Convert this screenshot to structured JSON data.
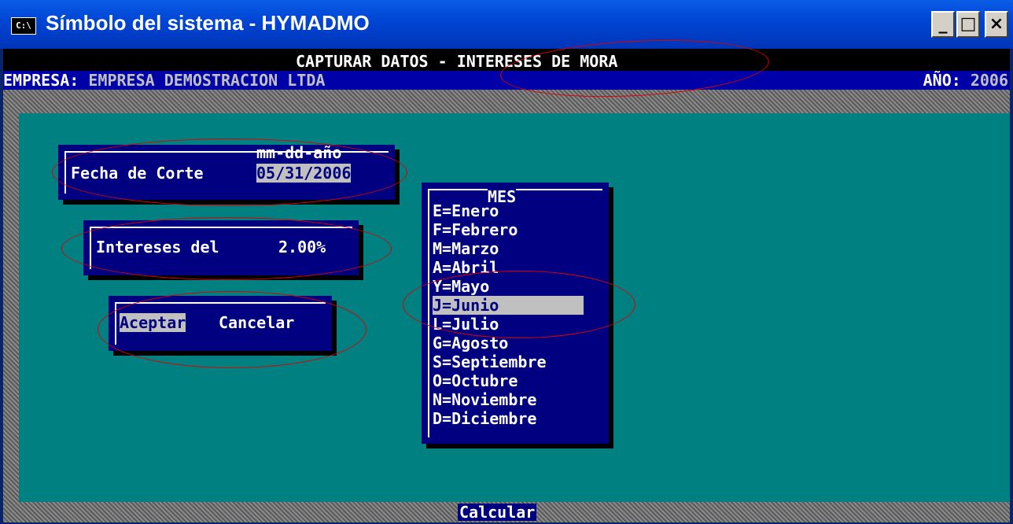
{
  "window": {
    "icon_text": "C:\\",
    "title": "Símbolo del sistema - HYMADMO",
    "minimize": "_",
    "maximize": "□",
    "close": "×"
  },
  "header": {
    "title": "CAPTURAR DATOS - INTERESES DE MORA",
    "empresa_label": "EMPRESA:",
    "empresa_value": "EMPRESA DEMOSTRACION LTDA",
    "year_label": "AÑO:",
    "year_value": "2006"
  },
  "fecha": {
    "format_hint": "mm-dd-año",
    "label": "Fecha de Corte",
    "value": "05/31/2006"
  },
  "intereses": {
    "label": "Intereses del",
    "value": "2.00%"
  },
  "actions": {
    "accept": "Aceptar",
    "cancel": "Cancelar",
    "calculate": "Calcular"
  },
  "mes": {
    "title": "MES",
    "selected": "J=Junio",
    "items": [
      "E=Enero",
      "F=Febrero",
      "M=Marzo",
      "A=Abril",
      "Y=Mayo",
      "J=Junio",
      "L=Julio",
      "G=Agosto",
      "S=Septiembre",
      "O=Octubre",
      "N=Noviembre",
      "D=Diciembre"
    ]
  },
  "annotation_color": "#e00000"
}
